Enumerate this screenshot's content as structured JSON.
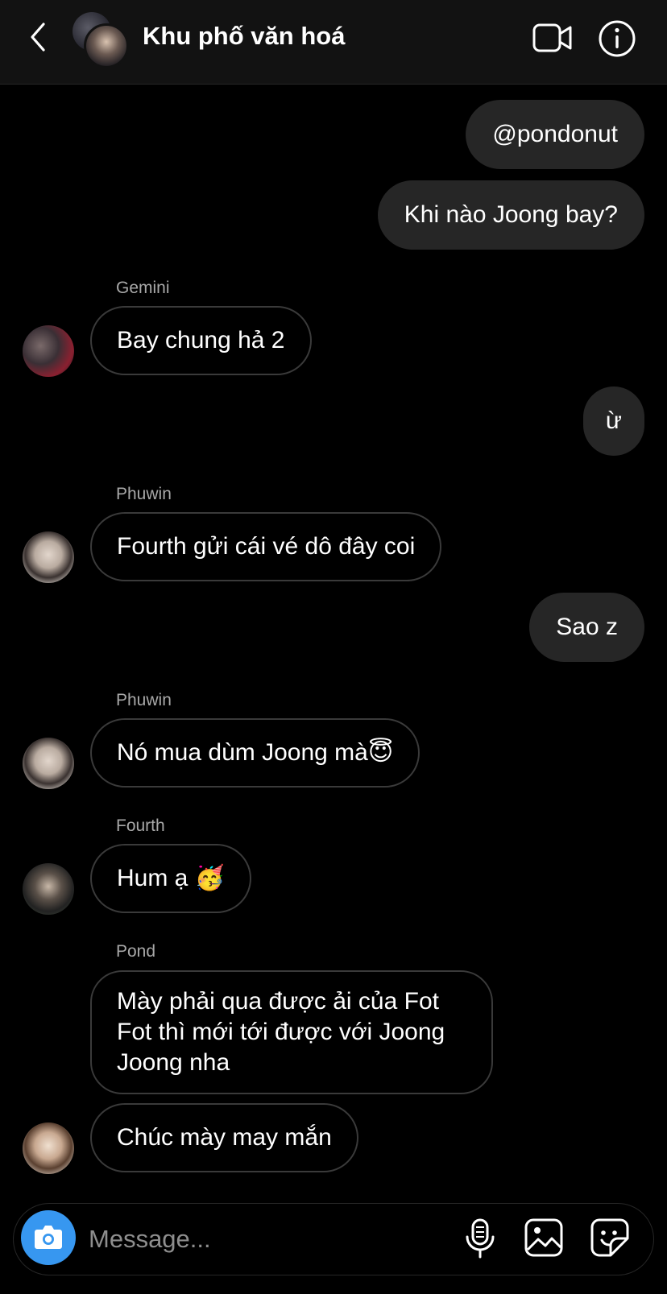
{
  "header": {
    "title": "Khu phố văn hoá",
    "icons": {
      "back": "chevron-left-icon",
      "video": "video-camera-icon",
      "info": "info-icon"
    }
  },
  "messages": [
    {
      "from": "me",
      "text": "@pondonut"
    },
    {
      "from": "me",
      "text": "Khi nào Joong bay?"
    },
    {
      "from": "Gemini",
      "sender_label": "Gemini",
      "text": "Bay chung hả 2"
    },
    {
      "from": "me",
      "text": "ừ"
    },
    {
      "from": "Phuwin",
      "sender_label": "Phuwin",
      "text": "Fourth gửi cái vé dô đây coi"
    },
    {
      "from": "me",
      "text": "Sao z"
    },
    {
      "from": "Phuwin",
      "sender_label": "Phuwin",
      "text": "Nó mua dùm Joong mà😇"
    },
    {
      "from": "Fourth",
      "sender_label": "Fourth",
      "text": "Hum ạ 🥳"
    },
    {
      "from": "Pond",
      "sender_label": "Pond",
      "text": "Mày phải qua được ải của Fot Fot thì mới tới được với Joong Joong nha"
    },
    {
      "from": "Pond",
      "text": "Chúc mày may mắn"
    }
  ],
  "composer": {
    "placeholder": "Message...",
    "camera_color": "#3797f0",
    "icons": {
      "camera": "camera-icon",
      "mic": "microphone-icon",
      "gallery": "image-icon",
      "sticker": "sticker-icon"
    }
  },
  "colors": {
    "background": "#000000",
    "header": "#121212",
    "outgoing_bubble": "#262626",
    "incoming_border": "#3a3a3a",
    "sender_label": "#a8a8a8"
  }
}
